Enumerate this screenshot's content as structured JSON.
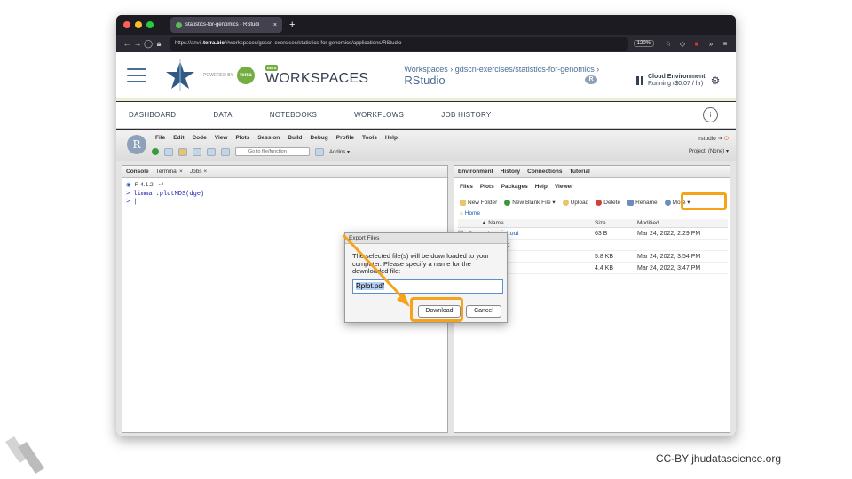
{
  "browser": {
    "tab_title": "statistics-for-genomics - RStudi",
    "new_tab": "+",
    "url_prefix": "https://anvil.",
    "url_domain": "terra.bio",
    "url_rest": "/#workspaces/gdscn-exercises/statistics-for-genomics/applications/RStudio",
    "zoom": "120%"
  },
  "terra": {
    "powered_by": "POWERED BY",
    "terra_badge": "terra",
    "beta": "BETA",
    "workspaces_title": "WORKSPACES",
    "breadcrumb": "Workspaces › gdscn-exercises/statistics-for-genomics ›",
    "app_title": "RStudio",
    "r_badge": "R",
    "cloud_title": "Cloud Environment",
    "cloud_status": "Running ($0.07 / hr)",
    "nav": [
      "DASHBOARD",
      "DATA",
      "NOTEBOOKS",
      "WORKFLOWS",
      "JOB HISTORY"
    ],
    "info": "i"
  },
  "rstudio": {
    "logo": "R",
    "menu": [
      "File",
      "Edit",
      "Code",
      "View",
      "Plots",
      "Session",
      "Build",
      "Debug",
      "Profile",
      "Tools",
      "Help"
    ],
    "goto_placeholder": "Go to file/function",
    "addins": "Addins ▾",
    "user": "rstudio",
    "project": "Project: (None) ▾",
    "left_tabs": [
      "Console",
      "Terminal ×",
      "Jobs ×"
    ],
    "r_version": "R 4.1.2 · ~/",
    "console_lines": [
      "> limma::plotMDS(dge)",
      "> |"
    ],
    "right_top_tabs": [
      "Environment",
      "History",
      "Connections",
      "Tutorial"
    ],
    "files_tabs": [
      "Files",
      "Plots",
      "Packages",
      "Help",
      "Viewer"
    ],
    "files_toolbar": [
      "New Folder",
      "New Blank File ▾",
      "Upload",
      "Delete",
      "Rename",
      "More ▾"
    ],
    "home": "Home",
    "table_headers": [
      "▲ Name",
      "Size",
      "Modified"
    ],
    "files": [
      {
        "name": "entrypoint.out",
        "size": "63 B",
        "modified": "Mar 24, 2022, 2:29 PM"
      },
      {
        "name": "lost+found",
        "size": "",
        "modified": ""
      },
      {
        "name": "...pg",
        "size": "5.8 KB",
        "modified": "Mar 24, 2022, 3:54 PM"
      },
      {
        "name": "...f",
        "size": "4.4 KB",
        "modified": "Mar 24, 2022, 3:47 PM"
      }
    ]
  },
  "dialog": {
    "title": "Export Files",
    "message": "The selected file(s) will be downloaded to your computer. Please specify a name for the downloaded file:",
    "filename": "Rplot.pdf",
    "download": "Download",
    "cancel": "Cancel"
  },
  "footer": "CC-BY jhudatascience.org",
  "colors": {
    "highlight": "#f5a31a",
    "terra_green": "#74ae43",
    "terra_blue": "#4a6d93"
  }
}
